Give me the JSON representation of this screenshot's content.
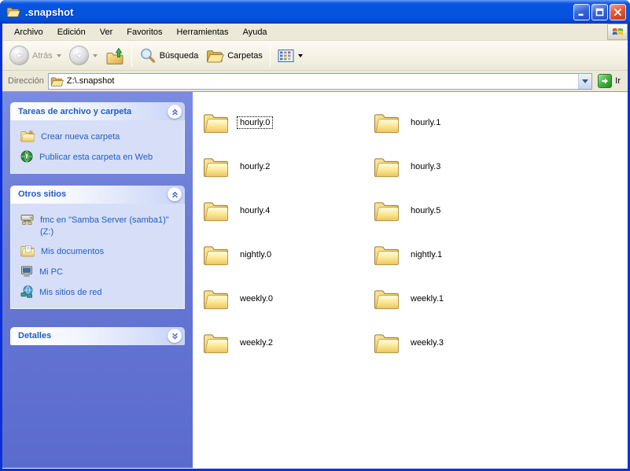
{
  "window": {
    "title": ".snapshot",
    "frame_color": "#0831D9",
    "titlebar_color": "#0353DF"
  },
  "menubar": {
    "items": [
      "Archivo",
      "Edición",
      "Ver",
      "Favoritos",
      "Herramientas",
      "Ayuda"
    ]
  },
  "toolbar": {
    "back_label": "Atrás",
    "search_label": "Búsqueda",
    "folders_label": "Carpetas"
  },
  "addressbar": {
    "label": "Dirección",
    "path_value": "Z:\\.snapshot",
    "go_label": "Ir"
  },
  "sidebar": {
    "background_color": "#6677D4",
    "link_color": "#215DC6",
    "panels": [
      {
        "title": "Tareas de archivo y carpeta",
        "collapsed": false,
        "items": [
          {
            "icon": "new-folder-icon",
            "label": "Crear nueva carpeta"
          },
          {
            "icon": "publish-web-icon",
            "label": "Publicar esta carpeta en Web"
          }
        ]
      },
      {
        "title": "Otros sitios",
        "collapsed": false,
        "items": [
          {
            "icon": "network-drive-icon",
            "label": "fmc en \"Samba Server (samba1)\" (Z:)"
          },
          {
            "icon": "my-documents-icon",
            "label": "Mis documentos"
          },
          {
            "icon": "my-computer-icon",
            "label": "Mi PC"
          },
          {
            "icon": "network-places-icon",
            "label": "Mis sitios de red"
          }
        ]
      },
      {
        "title": "Detalles",
        "collapsed": true,
        "items": []
      }
    ]
  },
  "content": {
    "view": "tiles",
    "folder_color": "#F3D97E",
    "focused_item": "hourly.0",
    "folders": [
      "hourly.0",
      "hourly.1",
      "hourly.2",
      "hourly.3",
      "hourly.4",
      "hourly.5",
      "nightly.0",
      "nightly.1",
      "weekly.0",
      "weekly.1",
      "weekly.2",
      "weekly.3"
    ]
  }
}
